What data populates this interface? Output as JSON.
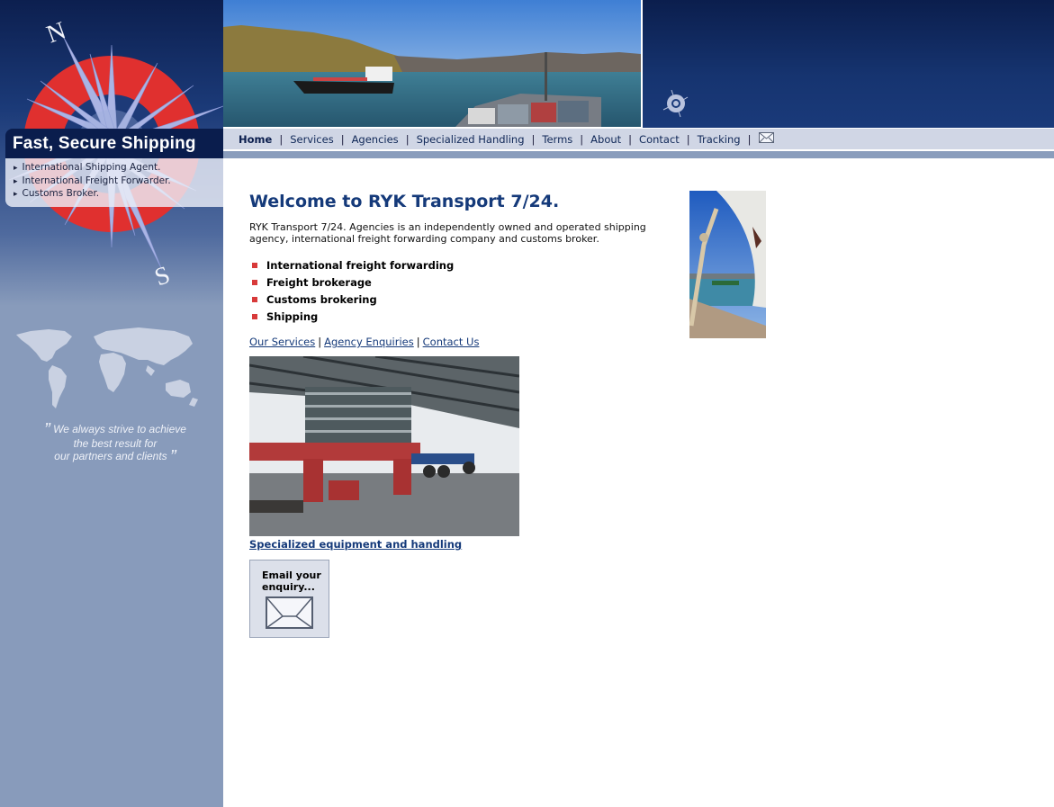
{
  "sidebar": {
    "compass_labels": {
      "north": "N",
      "south": "S"
    },
    "tagline": {
      "heading": "Fast, Secure Shipping",
      "items": [
        "International Shipping Agent.",
        "International Freight Forwarder.",
        "Customs Broker."
      ]
    },
    "quote": {
      "open_mark": "”",
      "lines": [
        "We always  strive to achieve",
        "the best result for",
        "our partners and clients"
      ],
      "close_mark": "”"
    }
  },
  "header": {
    "banner_alt": "Cargo ships in harbour",
    "icon": "ship-wheel-icon"
  },
  "nav": {
    "items": [
      {
        "label": "Home",
        "active": true
      },
      {
        "label": "Services"
      },
      {
        "label": "Agencies"
      },
      {
        "label": "Specialized Handling"
      },
      {
        "label": "Terms"
      },
      {
        "label": "About"
      },
      {
        "label": "Contact"
      },
      {
        "label": "Tracking"
      }
    ],
    "separator": "|",
    "mail_icon": "envelope-icon"
  },
  "main": {
    "title": "Welcome to RYK Transport 7/24.",
    "intro": "RYK Transport 7/24. Agencies is an independently owned and operated shipping agency, international freight forwarding company and customs broker.",
    "services": [
      "International freight forwarding",
      "Freight brokerage",
      "Customs brokering",
      "Shipping"
    ],
    "quick_links": [
      "Our Services",
      "Agency Enquiries",
      "Contact Us"
    ],
    "quick_links_separator": "|",
    "equipment_link": "Specialized equipment and handling",
    "email_box": {
      "line1": "Email your",
      "line2": "enquiry..."
    }
  },
  "colors": {
    "brand_navy": "#0a1d4d",
    "title_blue": "#153a7a",
    "nav_bg": "#d0d6e5",
    "sidebar_bg": "#889bbb",
    "bullet_red": "#d83a3a",
    "compass_red": "#e0302f"
  }
}
